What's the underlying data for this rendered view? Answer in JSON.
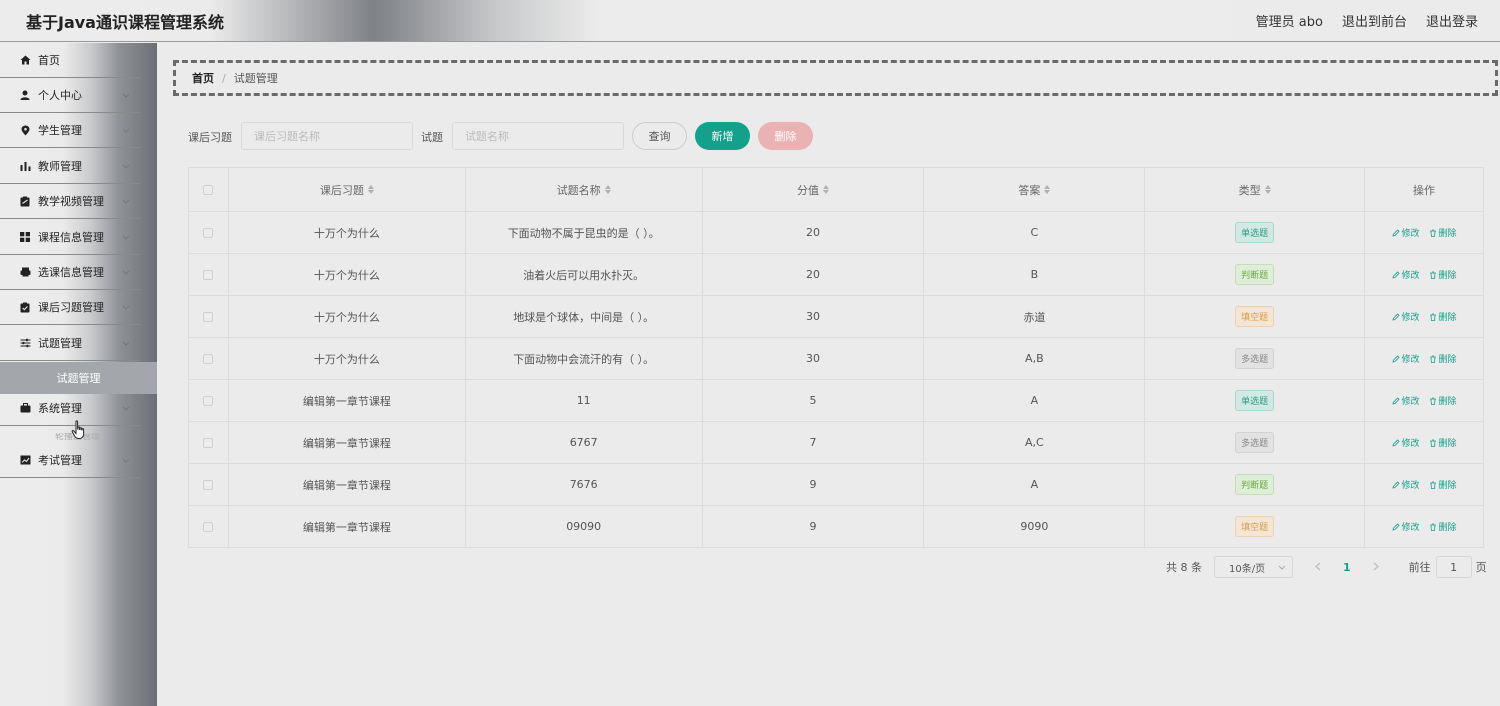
{
  "header": {
    "title": "基于Java通识课程管理系统",
    "user_label": "管理员 abo",
    "front_label": "退出到前台",
    "logout_label": "退出登录"
  },
  "sidebar": {
    "items": [
      {
        "label": "首页",
        "icon": "home-icon"
      },
      {
        "label": "个人中心",
        "icon": "user-icon"
      },
      {
        "label": "学生管理",
        "icon": "pin-icon"
      },
      {
        "label": "教师管理",
        "icon": "bar-chart-icon"
      },
      {
        "label": "教学视频管理",
        "icon": "clipboard-icon"
      },
      {
        "label": "课程信息管理",
        "icon": "grid-icon"
      },
      {
        "label": "选课信息管理",
        "icon": "printer-icon"
      },
      {
        "label": "课后习题管理",
        "icon": "clipboard-check-icon"
      },
      {
        "label": "试题管理",
        "icon": "sliders-icon"
      },
      {
        "label": "系统管理",
        "icon": "briefcase-icon"
      },
      {
        "label": "考试管理",
        "icon": "chart-box-icon"
      }
    ],
    "active_sub_label": "试题管理",
    "ghost_sub_label": "轮播图管理"
  },
  "breadcrumb": {
    "home": "首页",
    "separator": "/",
    "current": "试题管理"
  },
  "search": {
    "exercise_label": "课后习题",
    "exercise_placeholder": "课后习题名称",
    "question_label": "试题",
    "question_placeholder": "试题名称",
    "query_label": "查询",
    "add_label": "新增",
    "delete_label": "删除"
  },
  "table": {
    "headers": [
      "课后习题",
      "试题名称",
      "分值",
      "答案",
      "类型",
      "操作"
    ],
    "edit_label": "修改",
    "delete_label": "删除",
    "rows": [
      {
        "exercise": "十万个为什么",
        "name": "下面动物不属于昆虫的是（ ）。",
        "score": "20",
        "answer": "C",
        "type": "单选题"
      },
      {
        "exercise": "十万个为什么",
        "name": "油着火后可以用水扑灭。",
        "score": "20",
        "answer": "B",
        "type": "判断题"
      },
      {
        "exercise": "十万个为什么",
        "name": "地球是个球体，中间是（ ）。",
        "score": "30",
        "answer": "赤道",
        "type": "填空题"
      },
      {
        "exercise": "十万个为什么",
        "name": "下面动物中会流汗的有（ ）。",
        "score": "30",
        "answer": "A,B",
        "type": "多选题"
      },
      {
        "exercise": "编辑第一章节课程",
        "name": "11",
        "score": "5",
        "answer": "A",
        "type": "单选题"
      },
      {
        "exercise": "编辑第一章节课程",
        "name": "6767",
        "score": "7",
        "answer": "A,C",
        "type": "多选题"
      },
      {
        "exercise": "编辑第一章节课程",
        "name": "7676",
        "score": "9",
        "answer": "A",
        "type": "判断题"
      },
      {
        "exercise": "编辑第一章节课程",
        "name": "09090",
        "score": "9",
        "answer": "9090",
        "type": "填空题"
      }
    ]
  },
  "tag_colors": {
    "单选题": {
      "bg": "#d2e9e3",
      "border": "#a9d9cd",
      "text": "#2a9d84"
    },
    "判断题": {
      "bg": "#dfeed8",
      "border": "#c3e0b4",
      "text": "#6aaa45"
    },
    "填空题": {
      "bg": "#f3e6d6",
      "border": "#eed2ad",
      "text": "#d89a4a"
    },
    "多选题": {
      "bg": "#e2e2e2",
      "border": "#d2d2d2",
      "text": "#888888"
    }
  },
  "pagination": {
    "total": "共 8 条",
    "page_size": "10条/页",
    "current_page": "1",
    "goto_label": "前往",
    "goto_value": "1",
    "goto_suffix": "页"
  },
  "colors": {
    "accent": "#12a18a",
    "danger_light": "#eab2b2"
  }
}
